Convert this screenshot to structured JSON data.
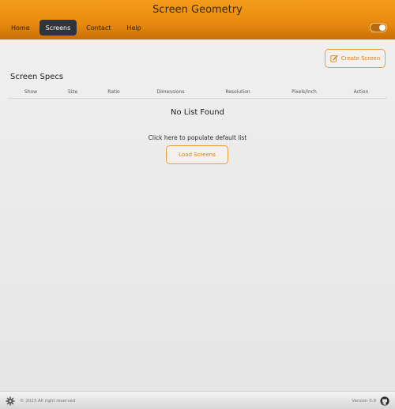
{
  "app": {
    "title": "Screen Geometry"
  },
  "nav": {
    "items": [
      {
        "label": "Home",
        "active": false
      },
      {
        "label": "Screens",
        "active": true
      },
      {
        "label": "Contact",
        "active": false
      },
      {
        "label": "Help",
        "active": false
      }
    ]
  },
  "theme_toggle": {
    "on": true
  },
  "toolbar": {
    "create_label": "Create Screen",
    "create_icon": "edit-icon"
  },
  "section": {
    "title": "Screen Specs"
  },
  "table": {
    "columns": [
      "Show",
      "Size",
      "Ratio",
      "Dimensions",
      "Resolution",
      "Pixels/Inch",
      "Action"
    ]
  },
  "empty_state": {
    "title": "No List Found",
    "hint": "Click here to populate default list",
    "load_label": "Load Screens"
  },
  "footer": {
    "copyright": "© 2023 All right reserved",
    "version": "Version 0.9",
    "left_icon": "gear-icon",
    "right_icon": "github-icon"
  },
  "colors": {
    "accent": "#f0931a",
    "header_dark": "#c86f05",
    "active_tab": "#2f3438",
    "button_text": "#e07f10"
  }
}
